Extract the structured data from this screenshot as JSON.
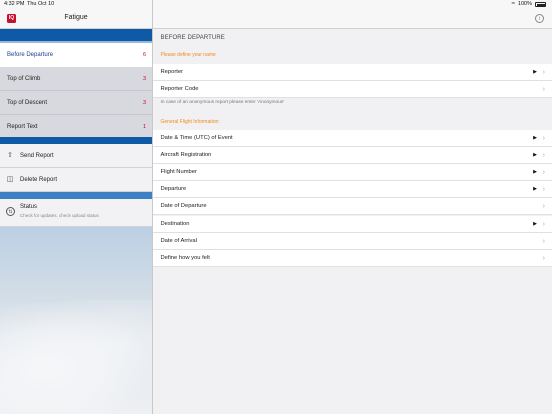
{
  "status_bar": {
    "time": "4:32 PM",
    "date": "Thu Oct 10",
    "battery": "100%"
  },
  "sidebar": {
    "logo": "IQ",
    "title": "Fatigue",
    "sections": [
      {
        "label": "Before Departure",
        "count": "6",
        "active": true
      },
      {
        "label": "Top of Climb",
        "count": "3",
        "active": false
      },
      {
        "label": "Top of Descent",
        "count": "3",
        "active": false
      },
      {
        "label": "Report Text",
        "count": "1",
        "active": false
      }
    ],
    "actions": [
      {
        "label": "Send Report",
        "icon": "share-icon"
      },
      {
        "label": "Delete Report",
        "icon": "trash-icon"
      }
    ],
    "status": {
      "title": "Status",
      "subtitle": "Check for updates, check upload status"
    }
  },
  "main": {
    "section_title": "BEFORE DEPARTURE",
    "group1_header": "Please define your name",
    "group1_rows": [
      {
        "label": "Reporter",
        "has_play": true
      },
      {
        "label": "Reporter Code",
        "has_play": false
      }
    ],
    "group1_note": "In case of an anonymous report please enter 'Anonymous'",
    "group2_header": "General Flight Information:",
    "group2_rows": [
      {
        "label": "Date & Time (UTC) of Event",
        "has_play": true
      },
      {
        "label": "Aircraft Registration",
        "has_play": true
      },
      {
        "label": "Flight Number",
        "has_play": true
      },
      {
        "label": "Departure",
        "has_play": true
      },
      {
        "label": "Date of Departure",
        "has_play": false
      },
      {
        "label": "Destination",
        "has_play": true
      },
      {
        "label": "Date of Arrival",
        "has_play": false
      },
      {
        "label": "Define how you felt",
        "has_play": false
      }
    ]
  },
  "colors": {
    "accent_blue": "#0e5aa7",
    "badge_red": "#d0021b",
    "orange": "#f08a1d",
    "logo_red": "#c8102e"
  }
}
